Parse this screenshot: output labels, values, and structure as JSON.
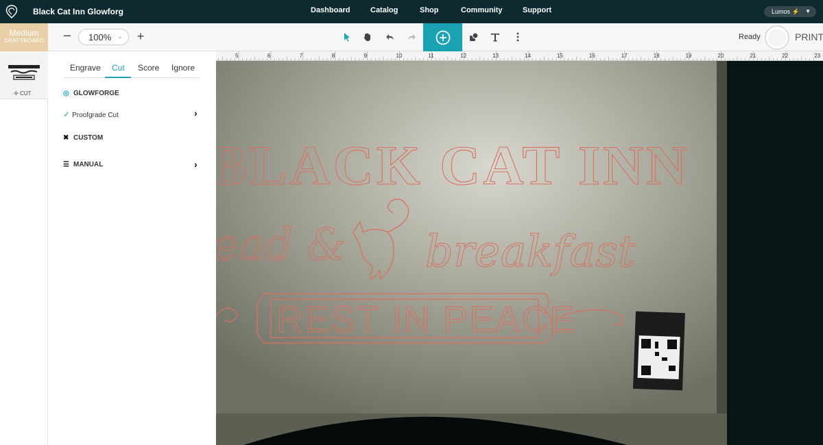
{
  "topnav": {
    "title": "Black Cat Inn  Glowforg",
    "items": [
      "Dashboard",
      "Catalog",
      "Shop",
      "Community",
      "Support"
    ],
    "machine": "Lumos ⚡"
  },
  "toolbar": {
    "material_name": "Medium",
    "material_type": "DRAFTBOARD",
    "zoom": "100%",
    "status": "Ready",
    "print_label": "PRINT"
  },
  "thumbnail": {
    "label": "CUT"
  },
  "panel": {
    "tabs": [
      "Engrave",
      "Cut",
      "Score",
      "Ignore"
    ],
    "glowforge_label": "GLOWFORGE",
    "proofgrade_label": "Proofgrade Cut",
    "custom_label": "CUSTOM",
    "manual_label": "MANUAL"
  },
  "ruler": {
    "marks": [
      "5",
      "6",
      "7",
      "8",
      "9",
      "10",
      "11",
      "12",
      "13",
      "14",
      "15",
      "16",
      "17",
      "18",
      "19",
      "20",
      "21",
      "22",
      "23"
    ]
  },
  "design": {
    "line1": "BLACK CAT INN",
    "line2a": "ead &",
    "line2b": "breakfast",
    "line3": "REST IN PEACE"
  },
  "colors": {
    "nav_bg": "#0d2a30",
    "accent": "#1ba3b3",
    "material": "#e8cfa8",
    "cut_line": "#d9705f"
  }
}
